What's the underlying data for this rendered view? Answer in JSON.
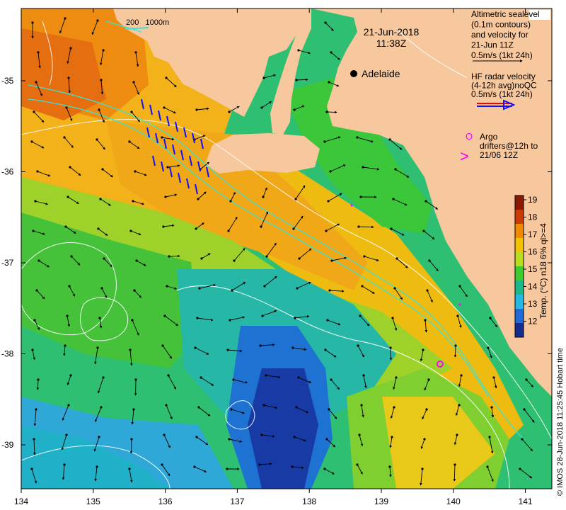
{
  "date": "21-Jun-2018",
  "time": "11:38Z",
  "city_label": "Adelaide",
  "legend": {
    "altimetry_lines": [
      "Altimetric sealevel",
      "(0.1m contours)",
      "and velocity for",
      "21-Jun 11Z",
      "0.5m/s (1kt 24h)"
    ],
    "hf_lines": [
      "HF radar velocity",
      "(4-12h avg)noQC",
      "0.5m/s (1kt 24h)"
    ],
    "argo_lines": [
      "Argo",
      "drifters@12h to",
      "21/06 12Z"
    ],
    "argo_symbol": "O",
    "drifter_symbol": ">"
  },
  "scale_bar": {
    "label": "200   1000m"
  },
  "colorbar": {
    "label": "Temp. (°C) n18 6% ql>=4",
    "ticks": [
      "19",
      "18",
      "17",
      "16",
      "15",
      "14",
      "13",
      "12"
    ],
    "colors": [
      "#8b1a00",
      "#cc3a00",
      "#f08a00",
      "#f2c200",
      "#b9dd1c",
      "#3ecb2e",
      "#1bb98a",
      "#25b8e0",
      "#1e6ad6",
      "#142c8e"
    ]
  },
  "credit": "© IMOS 28-Jun-2018 11:25:45 Hobart time",
  "x_axis_ticks": [
    "134",
    "135",
    "136",
    "137",
    "138",
    "139",
    "140",
    "141"
  ],
  "y_axis_ticks": [
    "-35",
    "-36",
    "-37",
    "-38",
    "-39"
  ],
  "colors": {
    "land": "#f7c79e",
    "argo": "#ff00ff",
    "hf_red": "#ff0000",
    "hf_blue": "#1010ff"
  }
}
